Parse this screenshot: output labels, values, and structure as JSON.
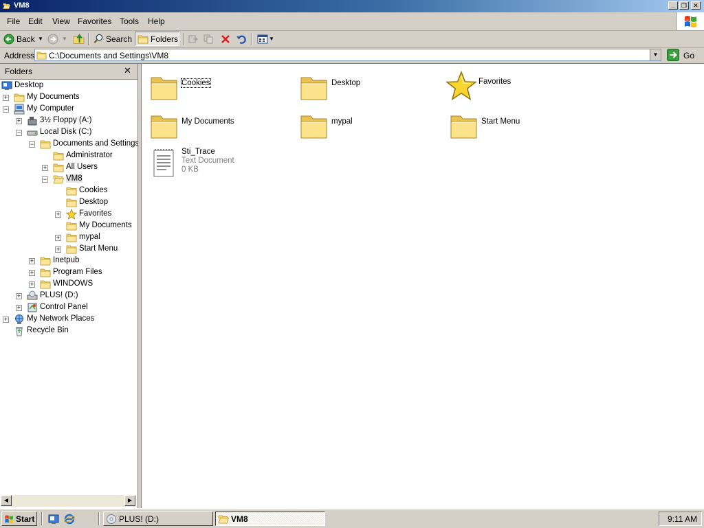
{
  "window": {
    "title": "VM8"
  },
  "menubar": {
    "items": [
      "File",
      "Edit",
      "View",
      "Favorites",
      "Tools",
      "Help"
    ]
  },
  "toolbar": {
    "back_label": "Back",
    "search_label": "Search",
    "folders_label": "Folders"
  },
  "address": {
    "label": "Address",
    "value": "C:\\Documents and Settings\\VM8",
    "go_label": "Go"
  },
  "folders_pane": {
    "title": "Folders",
    "tree": [
      {
        "label": "Desktop",
        "icon": "desktop-icon"
      },
      {
        "label": "My Documents",
        "icon": "folder-icon"
      },
      {
        "label": "My Computer",
        "icon": "computer-icon"
      },
      {
        "label": "3½ Floppy (A:)",
        "icon": "floppy-icon"
      },
      {
        "label": "Local Disk (C:)",
        "icon": "disk-icon"
      },
      {
        "label": "Documents and Settings",
        "icon": "folder-icon"
      },
      {
        "label": "Administrator",
        "icon": "folder-icon"
      },
      {
        "label": "All Users",
        "icon": "folder-icon"
      },
      {
        "label": "VM8",
        "icon": "folder-open-icon"
      },
      {
        "label": "Cookies",
        "icon": "folder-icon"
      },
      {
        "label": "Desktop",
        "icon": "folder-icon"
      },
      {
        "label": "Favorites",
        "icon": "star-icon"
      },
      {
        "label": "My Documents",
        "icon": "folder-icon"
      },
      {
        "label": "mypal",
        "icon": "folder-icon"
      },
      {
        "label": "Start Menu",
        "icon": "folder-icon"
      },
      {
        "label": "Inetpub",
        "icon": "folder-icon"
      },
      {
        "label": "Program Files",
        "icon": "folder-icon"
      },
      {
        "label": "WINDOWS",
        "icon": "folder-icon"
      },
      {
        "label": "PLUS! (D:)",
        "icon": "cd-icon"
      },
      {
        "label": "Control Panel",
        "icon": "control-panel-icon"
      },
      {
        "label": "My Network Places",
        "icon": "network-icon"
      },
      {
        "label": "Recycle Bin",
        "icon": "recycle-bin-icon"
      }
    ]
  },
  "content": {
    "items": [
      {
        "name": "Cookies",
        "icon": "folder-icon"
      },
      {
        "name": "Desktop",
        "icon": "folder-icon"
      },
      {
        "name": "Favorites",
        "icon": "star-icon"
      },
      {
        "name": "My Documents",
        "icon": "folder-icon"
      },
      {
        "name": "mypal",
        "icon": "folder-icon"
      },
      {
        "name": "Start Menu",
        "icon": "folder-icon"
      },
      {
        "name": "Sti_Trace",
        "icon": "text-document-icon",
        "type": "Text Document",
        "size": "0 KB"
      }
    ]
  },
  "taskbar": {
    "start_label": "Start",
    "tasks": [
      "PLUS! (D:)",
      "VM8"
    ],
    "clock": "9:11 AM"
  },
  "colors": {
    "titlebar_start": "#0a246a",
    "titlebar_end": "#a6caf0",
    "chrome": "#d4d0c8",
    "folder": "#f5d96b"
  }
}
